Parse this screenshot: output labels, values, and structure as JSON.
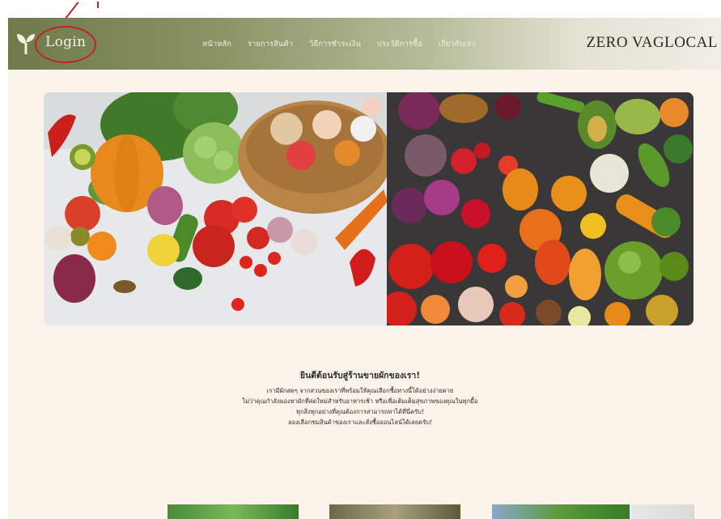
{
  "header": {
    "login_label": "Login",
    "nav_items": [
      "หน้าหลัก",
      "รายการสินค้า",
      "วิธีการชำระเงิน",
      "ประวัติการซื้อ",
      "เกี่ยวกับเรา"
    ],
    "brand": "ZERO VAGLOCAL"
  },
  "welcome": {
    "title": "ยินดีต้อนรับสู่ร้านขายผักของเรา!",
    "lines": [
      "เรามีผักสดๆ จากสวนของเราที่พร้อมให้คุณเลือกซื้อทางนี้ได้อย่างง่ายดาย",
      "ไม่ว่าคุณกำลังมองหาผักที่สดใหม่สำหรับอาหารเช้า หรือเพื่อเติมเต็มสุขภาพของคุณในทุกมื้อ",
      "ทุกสิ่งทุกอย่างที่คุณต้องการสามารถหาได้ที่นี่ครับ!",
      "ลองเลือกชมสินค้าของเราและสั่งซื้อออนไลน์ได้เลยครับ!"
    ]
  },
  "colors": {
    "accent": "#6f7a4a",
    "page_background": "#fcf3ea",
    "annotation": "#c0242a"
  },
  "icons": [
    "sprout-leaf-icon"
  ]
}
